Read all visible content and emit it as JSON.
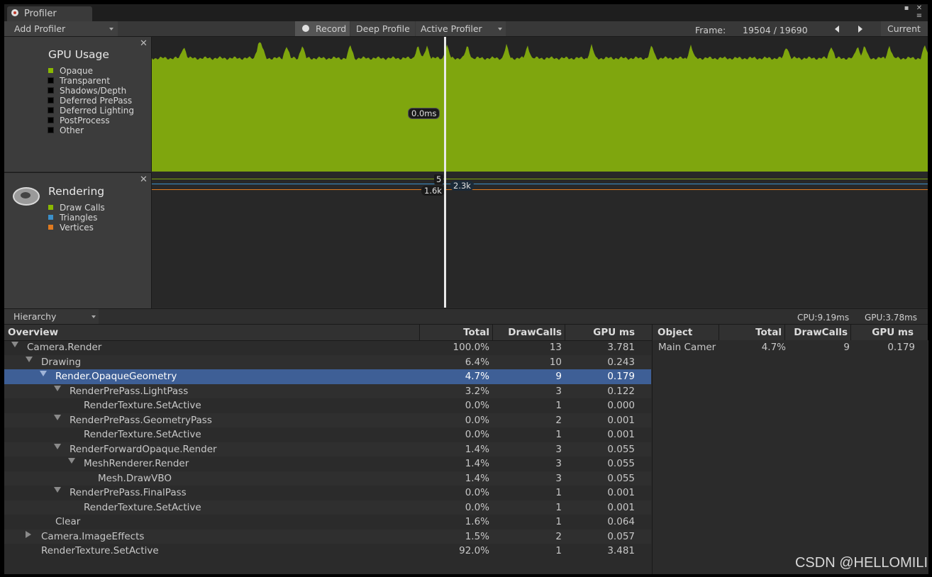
{
  "window": {
    "title": "Profiler"
  },
  "toolbar": {
    "add_profiler": "Add Profiler",
    "record": "Record",
    "deep_profile": "Deep Profile",
    "active_profiler": "Active Profiler",
    "frame_label": "Frame:",
    "frame_value": "19504 / 19690",
    "current": "Current"
  },
  "gpu_panel": {
    "title": "GPU Usage",
    "legend": [
      {
        "label": "Opaque",
        "color": "#8ab800"
      },
      {
        "label": "Transparent",
        "color": "#000000"
      },
      {
        "label": "Shadows/Depth",
        "color": "#000000"
      },
      {
        "label": "Deferred PrePass",
        "color": "#000000"
      },
      {
        "label": "Deferred Lighting",
        "color": "#000000"
      },
      {
        "label": "PostProcess",
        "color": "#000000"
      },
      {
        "label": "Other",
        "color": "#000000"
      }
    ],
    "graph_color": "#7fa60e",
    "marker_label": "0.0ms"
  },
  "rendering_panel": {
    "title": "Rendering",
    "legend": [
      {
        "label": "Draw Calls",
        "color": "#8ab800"
      },
      {
        "label": "Triangles",
        "color": "#3b8fc9"
      },
      {
        "label": "Vertices",
        "color": "#e07a1f"
      }
    ],
    "markers": {
      "draw_calls": "5",
      "vertices": "1.6k",
      "triangles": "2.3k"
    }
  },
  "hierarchy": {
    "mode": "Hierarchy",
    "cpu": "CPU:9.19ms",
    "gpu": "GPU:3.78ms",
    "columns": [
      "Overview",
      "Total",
      "DrawCalls",
      "GPU ms"
    ],
    "rows": [
      {
        "name": "Camera.Render",
        "total": "100.0%",
        "draws": "13",
        "gpu": "3.781"
      },
      {
        "name": "Drawing",
        "total": "6.4%",
        "draws": "10",
        "gpu": "0.243"
      },
      {
        "name": "Render.OpaqueGeometry",
        "total": "4.7%",
        "draws": "9",
        "gpu": "0.179"
      },
      {
        "name": "RenderPrePass.LightPass",
        "total": "3.2%",
        "draws": "3",
        "gpu": "0.122"
      },
      {
        "name": "RenderTexture.SetActive",
        "total": "0.0%",
        "draws": "1",
        "gpu": "0.000"
      },
      {
        "name": "RenderPrePass.GeometryPass",
        "total": "0.0%",
        "draws": "2",
        "gpu": "0.001"
      },
      {
        "name": "RenderTexture.SetActive",
        "total": "0.0%",
        "draws": "1",
        "gpu": "0.001"
      },
      {
        "name": "RenderForwardOpaque.Render",
        "total": "1.4%",
        "draws": "3",
        "gpu": "0.055"
      },
      {
        "name": "MeshRenderer.Render",
        "total": "1.4%",
        "draws": "3",
        "gpu": "0.055"
      },
      {
        "name": "Mesh.DrawVBO",
        "total": "1.4%",
        "draws": "3",
        "gpu": "0.055"
      },
      {
        "name": "RenderPrePass.FinalPass",
        "total": "0.0%",
        "draws": "1",
        "gpu": "0.001"
      },
      {
        "name": "RenderTexture.SetActive",
        "total": "0.0%",
        "draws": "1",
        "gpu": "0.001"
      },
      {
        "name": "Clear",
        "total": "1.6%",
        "draws": "1",
        "gpu": "0.064"
      },
      {
        "name": "Camera.ImageEffects",
        "total": "1.5%",
        "draws": "2",
        "gpu": "0.057"
      },
      {
        "name": "RenderTexture.SetActive",
        "total": "92.0%",
        "draws": "1",
        "gpu": "3.481"
      }
    ]
  },
  "object_table": {
    "columns": [
      "Object",
      "Total",
      "DrawCalls",
      "GPU ms"
    ],
    "rows": [
      {
        "name": "Main Camer",
        "total": "4.7%",
        "draws": "9",
        "gpu": "0.179"
      }
    ]
  },
  "watermark": "CSDN @HELLOMILI"
}
